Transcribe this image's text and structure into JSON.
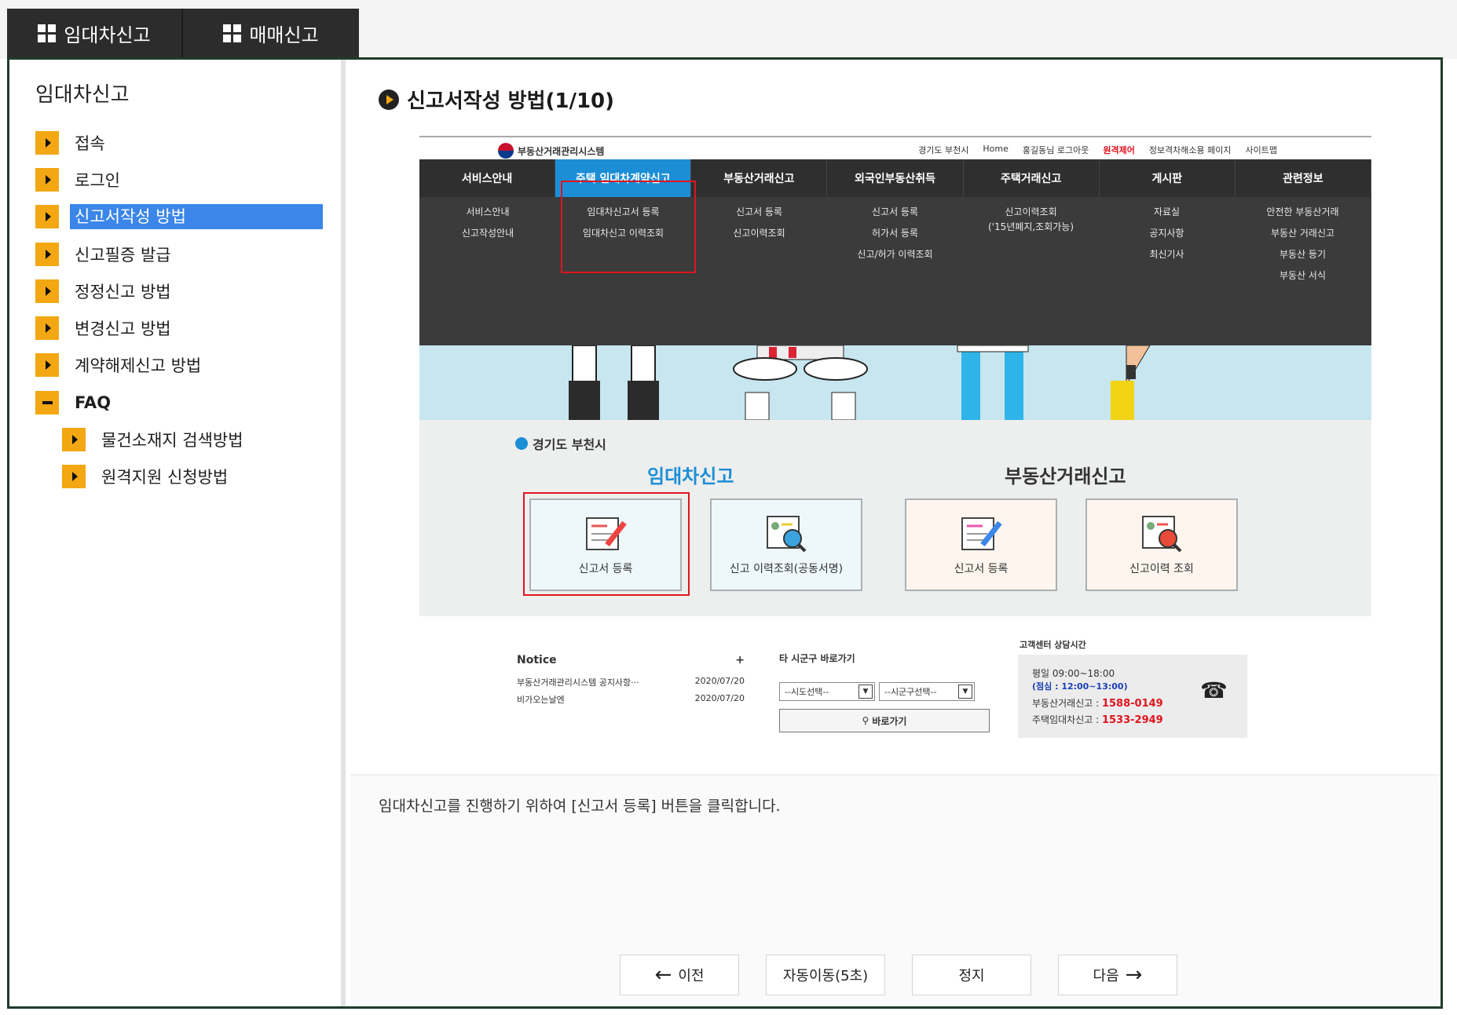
{
  "tabs": [
    {
      "label": "임대차신고",
      "icon": "grid-icon"
    },
    {
      "label": "매매신고",
      "icon": "grid-icon"
    }
  ],
  "sidebar": {
    "title": "임대차신고",
    "items": [
      {
        "label": "접속",
        "icon": "caret-right-icon"
      },
      {
        "label": "로그인",
        "icon": "caret-right-icon"
      },
      {
        "label": "신고서작성 방법",
        "icon": "caret-right-icon",
        "active": true
      },
      {
        "label": "신고필증 발급",
        "icon": "caret-right-icon"
      },
      {
        "label": "정정신고 방법",
        "icon": "caret-right-icon"
      },
      {
        "label": "변경신고 방법",
        "icon": "caret-right-icon"
      },
      {
        "label": "계약해제신고 방법",
        "icon": "caret-right-icon"
      },
      {
        "label": "FAQ",
        "icon": "minus-icon"
      },
      {
        "label": "물건소재지 검색방법",
        "icon": "caret-right-icon",
        "sub": true
      },
      {
        "label": "원격지원 신청방법",
        "icon": "caret-right-icon",
        "sub": true
      }
    ]
  },
  "main": {
    "title": "신고서작성 방법(1/10)",
    "caption": "임대차신고를 진행하기 위하여 [신고서 등록] 버튼을 클릭합니다.",
    "buttons": {
      "prev": "이전",
      "auto": "자동이동(5초)",
      "stop": "정지",
      "next": "다음"
    }
  },
  "screenshot": {
    "logo": "부동산거래관리시스템",
    "util": [
      "경기도 부천시",
      "Home",
      "홍길동님 로그아웃",
      "원격제어",
      "정보격차해소용 페이지",
      "사이트맵"
    ],
    "nav": [
      "서비스안내",
      "주택 임대차계약신고",
      "부동산거래신고",
      "외국인부동산취득",
      "주택거래신고",
      "게시판",
      "관련정보"
    ],
    "sub": [
      [
        "서비스안내",
        "신고작성안내"
      ],
      [
        "임대차신고서 등록",
        "임대차신고 이력조회"
      ],
      [
        "신고서 등록",
        "신고이력조회"
      ],
      [
        "신고서 등록",
        "허가서 등록",
        "신고/허가 이력조회"
      ],
      [
        "신고이력조회",
        "('15년폐지,조회가능)"
      ],
      [
        "자료실",
        "공지사항",
        "최신기사"
      ],
      [
        "안전한 부동산거래",
        "부동산 거래신고",
        "부동산 등기",
        "부동산 서식"
      ]
    ],
    "region": "경기도 부천시",
    "heading_left": "임대차신고",
    "heading_right": "부동산거래신고",
    "cards": [
      "신고서 등록",
      "신고 이력조회(공동서명)",
      "신고서 등록",
      "신고이력 조회"
    ],
    "notice": {
      "title": "Notice",
      "more": "+",
      "rows": [
        {
          "text": "부동산거래관리시스템 공지사항···",
          "date": "2020/07/20"
        },
        {
          "text": "비가오는날엔",
          "date": "2020/07/20"
        }
      ]
    },
    "shortcut": {
      "title": "타 시군구 바로가기",
      "sel1": "--시도선택--",
      "sel2": "--시군구선택--",
      "go": "바로가기"
    },
    "contact": {
      "title": "고객센터 상담시간",
      "hours": "평일 09:00~18:00",
      "lunch": "(점심 : 12:00~13:00)",
      "line1_label": "부동산거래신고 : ",
      "line1_num": "1588-0149",
      "line2_label": "주택임대차신고 : ",
      "line2_num": "1533-2949"
    }
  },
  "colors": {
    "accent_orange": "#f3a713",
    "active_blue": "#3b86e8",
    "tab_dark": "#2c2c2c",
    "frame_green": "#1f3b2a",
    "highlight_red": "#e0141e"
  }
}
